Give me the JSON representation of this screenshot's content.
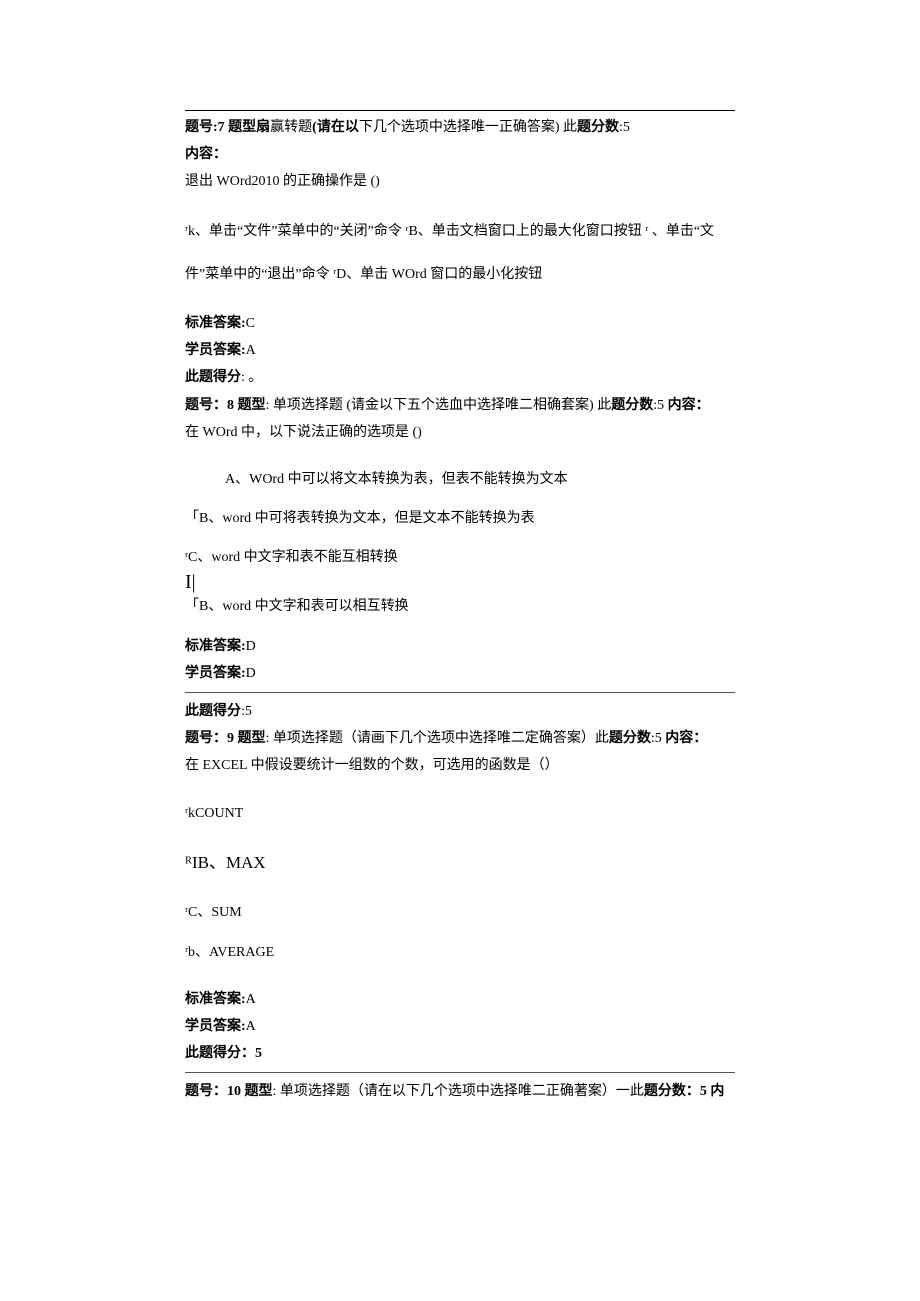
{
  "q7": {
    "header_pre": "题号:7 题型扇",
    "header_mid": "赢转题",
    "header_paren": "(请在以",
    "header_tail": "下几个选项中选择唯一正确答案) 此",
    "header_score_lbl": "题分数",
    "header_score_val": ":5",
    "content_lbl": "内容：",
    "content_text": "退出 WOrd2010 的正确操作是 ()",
    "options_line1": "ʳk、单击“文件”菜单中的“关闭”命令 ʳB、单击文档窗口上的最大化窗口按钮 ʳ 、单击“文",
    "options_line2": "件”菜单中的“退出”命令 ʳD、单击 WOrd 窗口的最小化按钮",
    "std_lbl": "标准答案:",
    "std_val": "C",
    "stu_lbl": "学员答案:",
    "stu_val": "A",
    "pts_lbl": "此题得分",
    "pts_val": ": 。"
  },
  "q8": {
    "header_num_lbl": "题号：8 题型",
    "header_type": ": 单项选择题 (请金以下五个选血中选择唯二相确套案) 此",
    "header_score_lbl": "题分数",
    "header_score_mid": ":5 ",
    "header_content_lbl": "内容：",
    "content_text": "在 WOrd 中，以下说法正确的选项是 ()",
    "opt_a": "A、WOrd 中可以将文本转换为表，但表不能转换为文本",
    "opt_b": "「B、word 中可将表转换为文本，但是文本不能转换为表",
    "opt_c": "ʳC、word 中文字和表不能互相转换",
    "opt_ib": "I|",
    "opt_d": "「B、word 中文字和表可以相互转换",
    "std_lbl": "标准答案:",
    "std_val": "D",
    "stu_lbl": "学员答案:",
    "stu_val": "D",
    "pts_lbl": "此题得分",
    "pts_val": ":5"
  },
  "q9": {
    "header_num_lbl": "题号：9 题型",
    "header_type": ": 单项选择题（请画下几个选项中选择唯二定确答案）此",
    "header_score_lbl": "题分数",
    "header_score_mid": ":5 ",
    "header_content_lbl": "内容：",
    "content_text": "在 EXCEL 中假设要统计一组数的个数，可选用的函数是（）",
    "opt_a": "ʳkCOUNT",
    "opt_b": "ᴿIB、MAX",
    "opt_c": "ʳC、SUM",
    "opt_d": "ʳb、AVERAGE",
    "std_lbl": "标准答案:",
    "std_val": "A",
    "stu_lbl": "学员答案:",
    "stu_val": "A",
    "pts_lbl": "此题得分：5"
  },
  "q10": {
    "header_num_lbl": "题号：10 题型",
    "header_type": ": 单项选择题（请在以下几个选项中选择唯二正确著案）一此",
    "header_score_lbl": "题分数：5 内"
  }
}
